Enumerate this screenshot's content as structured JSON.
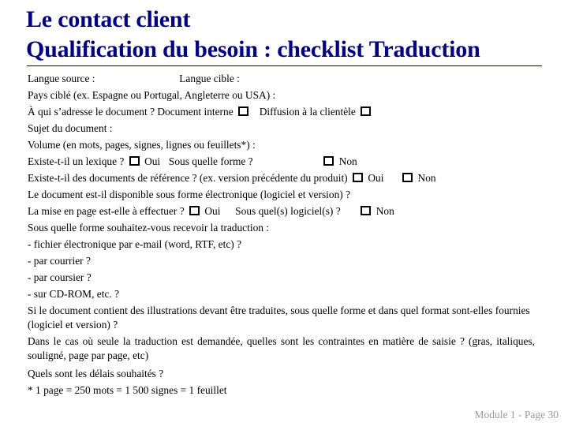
{
  "title": {
    "line1": "Le contact client",
    "line2": "Qualification du besoin : checklist Traduction"
  },
  "colors": {
    "title": "#000080",
    "body_text": "#000000",
    "footer": "#999999",
    "rule": "#000033"
  },
  "checklist": {
    "langue_source": "Langue source :",
    "langue_cible": "Langue cible :",
    "pays_cible": "Pays ciblé (ex. Espagne ou Portugal, Angleterre ou USA) :",
    "destinataire": {
      "question": "À qui s’adresse le document ? Document interne",
      "option2": "Diffusion à la clientèle"
    },
    "sujet": "Sujet du document :",
    "volume": "Volume (en mots, pages, signes, lignes ou feuillets*) :",
    "lexique": {
      "question": "Existe-t-il un lexique ?",
      "oui": "Oui",
      "forme": "Sous quelle forme ?",
      "non": "Non"
    },
    "references": {
      "question": "Existe-t-il des documents de référence ? (ex. version précédente du produit)",
      "oui": "Oui",
      "non": "Non"
    },
    "electronique": "Le document est-il disponible sous forme électronique (logiciel et version) ?",
    "mise_en_page": {
      "question": "La mise en page est-elle à effectuer ?",
      "oui": "Oui",
      "logiciel": "Sous quel(s) logiciel(s) ?",
      "non": "Non"
    },
    "reception": {
      "question": "Sous quelle forme souhaitez-vous recevoir la traduction :",
      "options": [
        "- fichier électronique par e-mail (word, RTF, etc) ?",
        "- par courrier ?",
        "- par coursier ?",
        "- sur CD-ROM, etc. ?"
      ]
    },
    "illustrations": "Si le document contient des illustrations devant être traduites, sous quelle forme et dans quel format sont-elles fournies (logiciel et version) ?",
    "contraintes": "Dans le cas où seule la traduction est demandée, quelles sont les contraintes en matière de saisie ? (gras, italiques, souligné, page par page, etc)",
    "delais": "Quels sont les délais souhaités ?",
    "note": "* 1 page = 250 mots = 1 500 signes = 1 feuillet"
  },
  "footer": {
    "label": "Module 1 - Page 30"
  }
}
